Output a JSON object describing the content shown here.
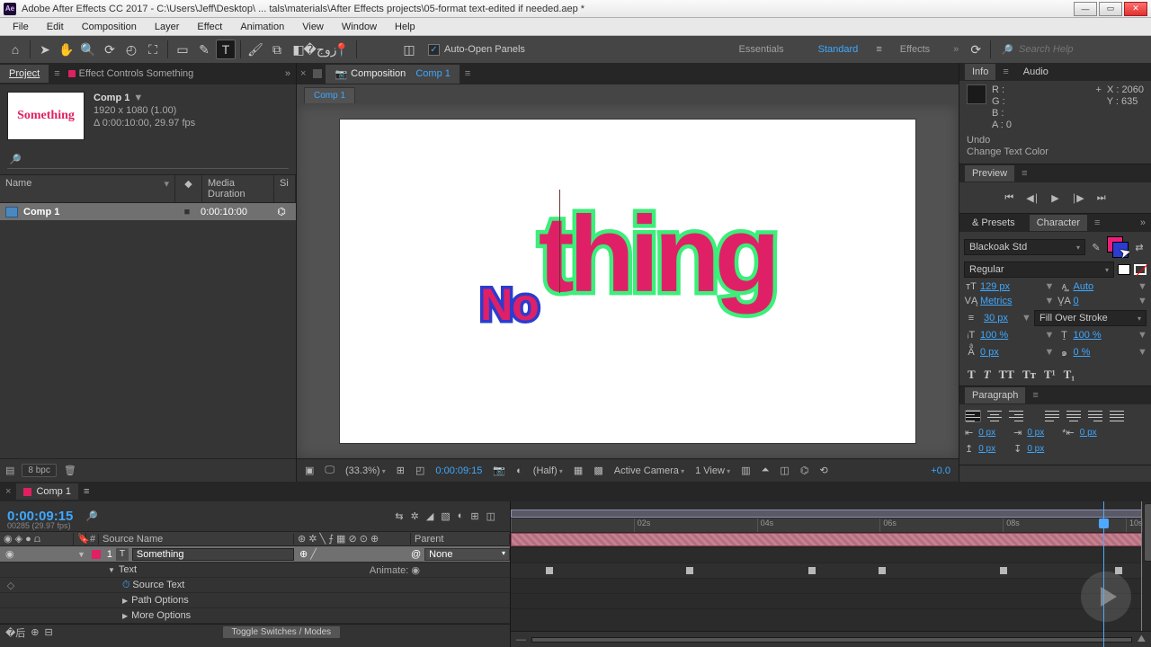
{
  "title": "Adobe After Effects CC 2017 - C:\\Users\\Jeff\\Desktop\\ ... tals\\materials\\After Effects projects\\05-format text-edited if needed.aep *",
  "menu": [
    "File",
    "Edit",
    "Composition",
    "Layer",
    "Effect",
    "Animation",
    "View",
    "Window",
    "Help"
  ],
  "toolbar": {
    "auto_open": "Auto-Open Panels"
  },
  "workspaces": {
    "a": "Essentials",
    "b": "Standard",
    "c": "Effects"
  },
  "search_placeholder": "Search Help",
  "project": {
    "tab_project": "Project",
    "tab_effects": "Effect Controls Something",
    "thumb_text": "Something",
    "comp_name": "Comp 1",
    "comp_res": "1920 x 1080 (1.00)",
    "comp_dur": "Δ 0:00:10:00, 29.97 fps",
    "head_name": "Name",
    "head_type": "◆",
    "head_dur": "Media Duration",
    "head_si": "Si",
    "row_name": "Comp 1",
    "row_dur": "0:00:10:00",
    "bpc": "8 bpc"
  },
  "comp": {
    "tab_prefix": "Composition",
    "tab_name": "Comp 1",
    "subtab": "Comp 1",
    "txt_no": "No",
    "txt_thing": "thing",
    "zoom": "(33.3%)",
    "time": "0:00:09:15",
    "res": "(Half)",
    "camera": "Active Camera",
    "views": "1 View",
    "plus": "+0.0"
  },
  "info": {
    "tab_info": "Info",
    "tab_audio": "Audio",
    "r": "R :",
    "g": "G :",
    "b": "B :",
    "a": "A :  0",
    "x": "X : 2060",
    "y": "Y :   635",
    "hist1": "Undo",
    "hist2": "Change Text Color"
  },
  "preview": {
    "tab": "Preview"
  },
  "presets": {
    "label": "& Presets"
  },
  "character": {
    "tab": "Character",
    "font": "Blackoak Std",
    "style": "Regular",
    "size": "129 px",
    "leading": "Auto",
    "kerning": "Metrics",
    "tracking": "0",
    "stroke_w": "30 px",
    "stroke_mode": "Fill Over Stroke",
    "vscale": "100 %",
    "hscale": "100 %",
    "baseline": "0 px",
    "tsume": "0 %"
  },
  "paragraph": {
    "tab": "Paragraph",
    "indent_left": "0 px",
    "indent_right": "0 px",
    "indent_first": "0 px",
    "space_before": "0 px",
    "space_after": "0 px"
  },
  "timeline": {
    "tab": "Comp 1",
    "time": "0:00:09:15",
    "fps": "00285 (29.97 fps)",
    "head_source": "Source Name",
    "head_parent": "Parent",
    "layer_num": "1",
    "layer_name": "Something",
    "parent_val": "None",
    "sub_text": "Text",
    "animate": "Animate:",
    "sub_src": "Source Text",
    "sub_path": "Path Options",
    "sub_more": "More Options",
    "toggle": "Toggle Switches / Modes",
    "ticks": [
      "",
      "02s",
      "04s",
      "06s",
      "08s",
      "10s"
    ]
  }
}
